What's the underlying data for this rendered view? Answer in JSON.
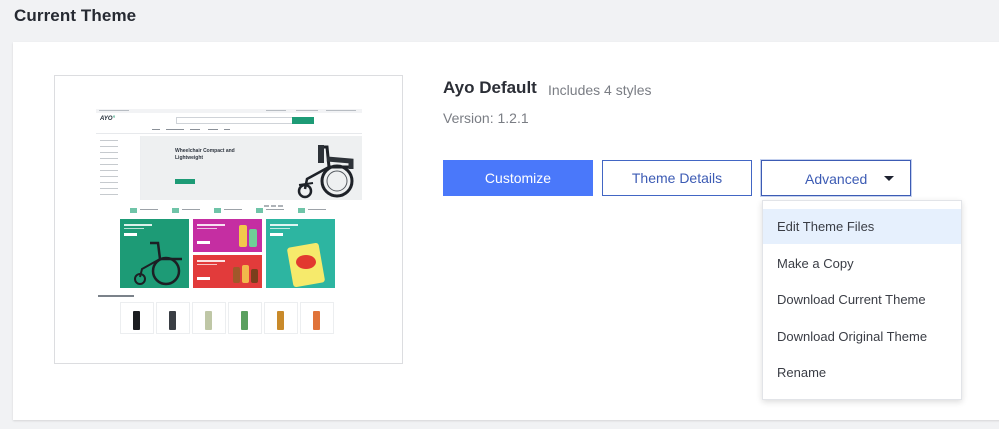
{
  "header": {
    "title": "Current Theme"
  },
  "theme": {
    "name": "Ayo Default",
    "styles": "Includes 4 styles",
    "version": "Version: 1.2.1"
  },
  "preview": {
    "hero_title": "Wheelchair Compact and Lightweight",
    "logo": "AYO"
  },
  "buttons": {
    "customize": "Customize",
    "details": "Theme Details",
    "advanced": "Advanced"
  },
  "dropdown": {
    "items": [
      {
        "label": "Edit Theme Files"
      },
      {
        "label": "Make a Copy"
      },
      {
        "label": "Download Current Theme"
      },
      {
        "label": "Download Original Theme"
      },
      {
        "label": "Rename"
      }
    ]
  },
  "colors": {
    "primary": "#4a78fa",
    "outline": "#3c5bb4",
    "active_item_bg": "#e6f0fd",
    "brand_green": "#1d9b76"
  }
}
